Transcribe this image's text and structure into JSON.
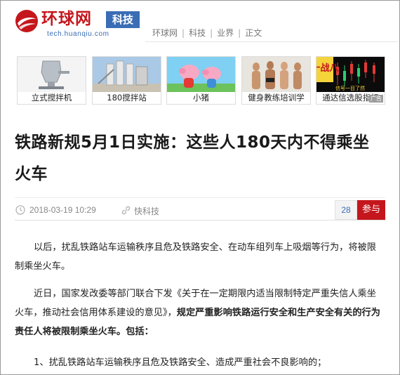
{
  "header": {
    "site_name": "环球网",
    "channel_tag": "科技",
    "site_url": "tech.huanqiu.com",
    "breadcrumb": [
      "环球网",
      "科技",
      "业界",
      "正文"
    ]
  },
  "ads": {
    "items": [
      {
        "label": "立式搅拌机"
      },
      {
        "label": "180搅拌站"
      },
      {
        "label": "小猪"
      },
      {
        "label": "健身教练培训学"
      },
      {
        "label": "通达信选股指标",
        "overlay_text": "十战八",
        "overlay_text2": "信号一目了然"
      }
    ],
    "ad_marker": "广告"
  },
  "article": {
    "title": "铁路新规5月1日实施：这些人180天内不得乘坐火车",
    "date": "2018-03-19 10:29",
    "source": "快科技",
    "comment_count": "28",
    "join_label": "参与",
    "paragraphs": {
      "p1": "以后，扰乱铁路站车运输秩序且危及铁路安全、在动车组列车上吸烟等行为，将被限制乘坐火车。",
      "p2_plain": "近日，国家发改委等部门联合下发《关于在一定期限内适当限制特定严重失信人乘坐火车，推动社会信用体系建设的意见》，",
      "p2_bold": "规定严重影响铁路运行安全和生产安全有关的行为责任人将被限制乘坐火车。包括：",
      "p3": "1、扰乱铁路站车运输秩序且危及铁路安全、造成严重社会不良影响的；"
    }
  },
  "colors": {
    "brand_red": "#c4161c",
    "brand_blue": "#3a6db5"
  }
}
